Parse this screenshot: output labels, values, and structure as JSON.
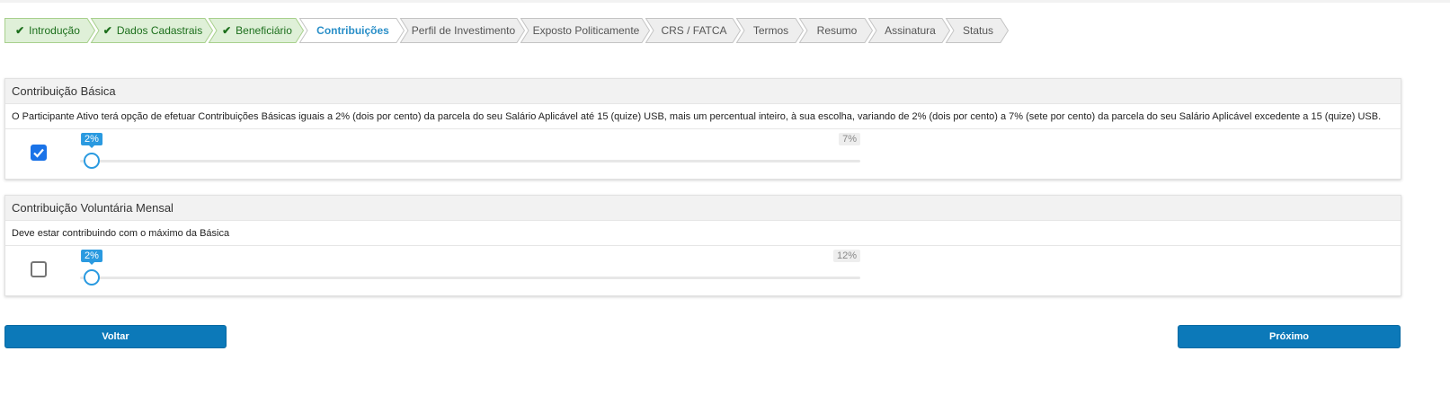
{
  "wizard": {
    "steps": [
      {
        "label": "Introdução",
        "status": "done"
      },
      {
        "label": "Dados Cadastrais",
        "status": "done"
      },
      {
        "label": "Beneficiário",
        "status": "done"
      },
      {
        "label": "Contribuições",
        "status": "active"
      },
      {
        "label": "Perfil de Investimento",
        "status": "todo"
      },
      {
        "label": "Exposto Politicamente",
        "status": "todo"
      },
      {
        "label": "CRS / FATCA",
        "status": "todo"
      },
      {
        "label": "Termos",
        "status": "todo"
      },
      {
        "label": "Resumo",
        "status": "todo"
      },
      {
        "label": "Assinatura",
        "status": "todo"
      },
      {
        "label": "Status",
        "status": "todo"
      }
    ],
    "check_icon": "checkmark-icon"
  },
  "basic": {
    "title": "Contribuição Básica",
    "description": "O Participante Ativo terá opção de efetuar Contribuições Básicas iguais a 2% (dois por cento) da parcela do seu Salário Aplicável até 15 (quize) USB, mais um percentual inteiro, à sua escolha, variando de 2% (dois por cento) a 7% (sete por cento) da parcela do seu Salário Aplicável excedente a 15 (quize) USB.",
    "checked": true,
    "slider": {
      "value_label": "2%",
      "max_label": "7%",
      "min": 2,
      "max": 7,
      "value": 2
    }
  },
  "voluntary": {
    "title": "Contribuição Voluntária Mensal",
    "description": "Deve estar contribuindo com o máximo da Básica",
    "checked": false,
    "slider": {
      "value_label": "2%",
      "max_label": "12%",
      "min": 2,
      "max": 12,
      "value": 2
    }
  },
  "buttons": {
    "back": "Voltar",
    "next": "Próximo"
  },
  "colors": {
    "done_bg": "#dff0d8",
    "done_border": "#a8d08d",
    "done_text": "#1c6f1c",
    "active_bg": "#ffffff",
    "active_text": "#2a8fc8",
    "todo_bg": "#eeeeee",
    "todo_border": "#c4c4c4",
    "primary": "#0c79b9",
    "slider_accent": "#2a9ae0"
  }
}
